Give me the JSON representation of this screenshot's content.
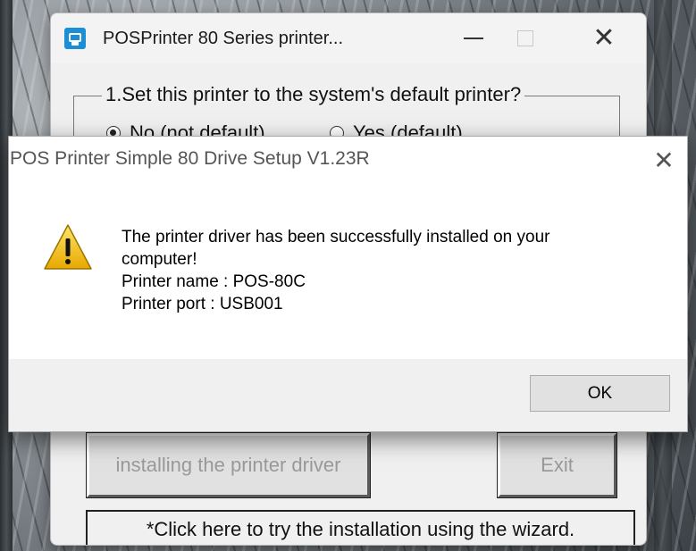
{
  "installer": {
    "title": "POSPrinter 80 Series printer...",
    "question": "1.Set this printer to the system's default printer?",
    "options": [
      {
        "label": "No (not default)",
        "selected": true
      },
      {
        "label": "Yes (default)",
        "selected": false
      }
    ],
    "install_label": "installing the printer driver",
    "exit_label": "Exit",
    "wizard_label": "*Click here to try the installation using the wizard."
  },
  "dialog": {
    "title": "POS Printer Simple 80 Drive Setup V1.23R",
    "icon": "warning-icon",
    "message_lines": [
      "The printer driver has been successfully installed on your",
      "computer!",
      "Printer name : POS-80C",
      "Printer port : USB001"
    ],
    "ok_label": "OK"
  },
  "colors": {
    "accent": "#1b8fd6",
    "warning": "#f2c300"
  }
}
